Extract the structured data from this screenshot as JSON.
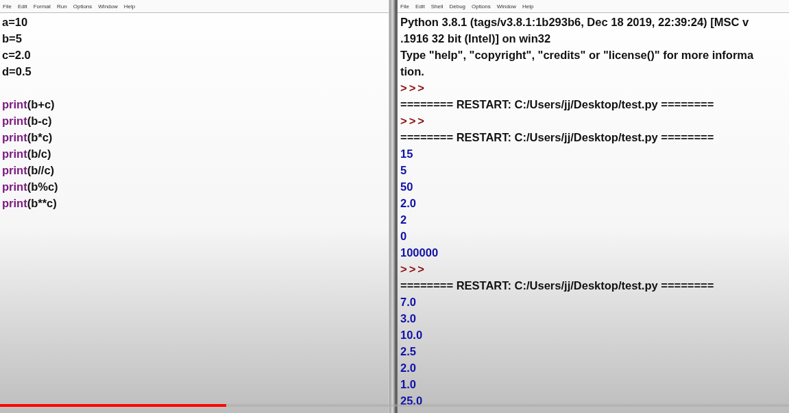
{
  "editor": {
    "menu": [
      "File",
      "Edit",
      "Format",
      "Run",
      "Options",
      "Window",
      "Help"
    ],
    "lines": [
      {
        "kind": "plain",
        "text": "a=10"
      },
      {
        "kind": "plain",
        "text": "b=5"
      },
      {
        "kind": "plain",
        "text": "c=2.0"
      },
      {
        "kind": "plain",
        "text": "d=0.5"
      },
      {
        "kind": "blank"
      },
      {
        "kind": "call",
        "keyword": "print",
        "text": "(b+c)"
      },
      {
        "kind": "call",
        "keyword": "print",
        "text": "(b-c)"
      },
      {
        "kind": "call",
        "keyword": "print",
        "text": "(b*c)"
      },
      {
        "kind": "call",
        "keyword": "print",
        "text": "(b/c)"
      },
      {
        "kind": "call",
        "keyword": "print",
        "text": "(b//c)"
      },
      {
        "kind": "call",
        "keyword": "print",
        "text": "(b%c)"
      },
      {
        "kind": "call",
        "keyword": "print",
        "text": "(b**c)"
      }
    ]
  },
  "shell": {
    "menu": [
      "File",
      "Edit",
      "Shell",
      "Debug",
      "Options",
      "Window",
      "Help"
    ],
    "lines": [
      {
        "kind": "banner",
        "text": "Python 3.8.1 (tags/v3.8.1:1b293b6, Dec 18 2019, 22:39:24) [MSC v"
      },
      {
        "kind": "banner",
        "text": ".1916 32 bit (Intel)] on win32"
      },
      {
        "kind": "banner",
        "text": "Type \"help\", \"copyright\", \"credits\" or \"license()\" for more informa"
      },
      {
        "kind": "banner",
        "text": "tion."
      },
      {
        "kind": "prompt",
        "text": ">>>"
      },
      {
        "kind": "restart",
        "text": "======== RESTART: C:/Users/jj/Desktop/test.py ========"
      },
      {
        "kind": "prompt",
        "text": ">>>"
      },
      {
        "kind": "restart",
        "text": "======== RESTART: C:/Users/jj/Desktop/test.py ========"
      },
      {
        "kind": "output",
        "text": "15"
      },
      {
        "kind": "output",
        "text": "5"
      },
      {
        "kind": "output",
        "text": "50"
      },
      {
        "kind": "output",
        "text": "2.0"
      },
      {
        "kind": "output",
        "text": "2"
      },
      {
        "kind": "output",
        "text": "0"
      },
      {
        "kind": "output",
        "text": "100000"
      },
      {
        "kind": "prompt",
        "text": ">>>"
      },
      {
        "kind": "restart",
        "text": "======== RESTART: C:/Users/jj/Desktop/test.py ========"
      },
      {
        "kind": "output",
        "text": "7.0"
      },
      {
        "kind": "output",
        "text": "3.0"
      },
      {
        "kind": "output",
        "text": "10.0"
      },
      {
        "kind": "output",
        "text": "2.5"
      },
      {
        "kind": "output",
        "text": "2.0"
      },
      {
        "kind": "output",
        "text": "1.0"
      },
      {
        "kind": "output",
        "text": "25.0"
      }
    ]
  },
  "video_progress": {
    "level": 0.287
  }
}
